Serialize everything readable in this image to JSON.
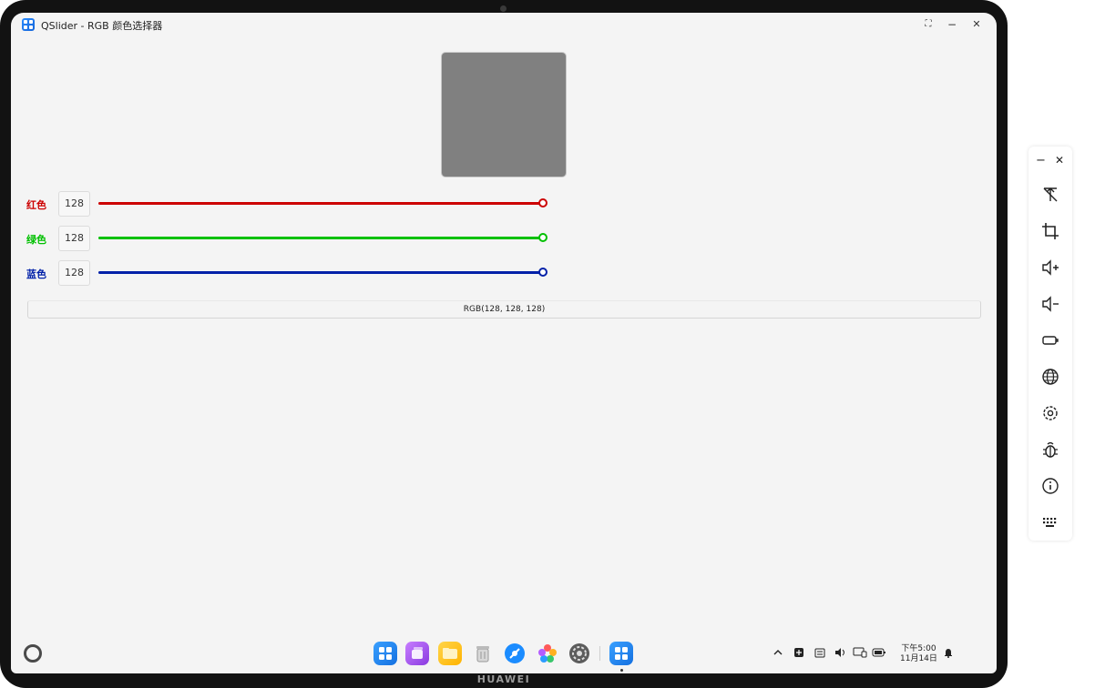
{
  "window": {
    "title": "QSlider - RGB 颜色选择器",
    "controls": {
      "restore": "⛶",
      "minimize": "−",
      "close": "✕"
    }
  },
  "preview": {
    "color": "#808080"
  },
  "sliders": [
    {
      "label": "红色",
      "value": "128",
      "level": 1.0,
      "color": "#cc0000"
    },
    {
      "label": "绿色",
      "value": "128",
      "level": 1.0,
      "color": "#00c000"
    },
    {
      "label": "蓝色",
      "value": "128",
      "level": 1.0,
      "color": "#0020a8"
    }
  ],
  "output": {
    "text": "RGB(128, 128, 128)"
  },
  "taskbar": {
    "dock_apps": [
      "app-center-icon",
      "multitask-icon",
      "files-icon",
      "trash-icon",
      "browser-icon",
      "photos-icon",
      "settings-icon",
      "qslider-app-icon"
    ],
    "tray": [
      "chevron-up-icon",
      "input-icon",
      "clipboard-icon",
      "volume-icon",
      "display-icon",
      "battery-icon"
    ],
    "clock": {
      "time": "下午5:00",
      "date": "11月14日"
    }
  },
  "device": {
    "brand": "HUAWEI"
  },
  "side_toolbar": {
    "top": {
      "minimize": "−",
      "close": "✕"
    },
    "items": [
      "pin-off-icon",
      "crop-icon",
      "volume-up-icon",
      "volume-down-icon",
      "power-icon",
      "globe-icon",
      "gear-icon",
      "bug-icon",
      "info-icon",
      "keyboard-icon"
    ]
  }
}
